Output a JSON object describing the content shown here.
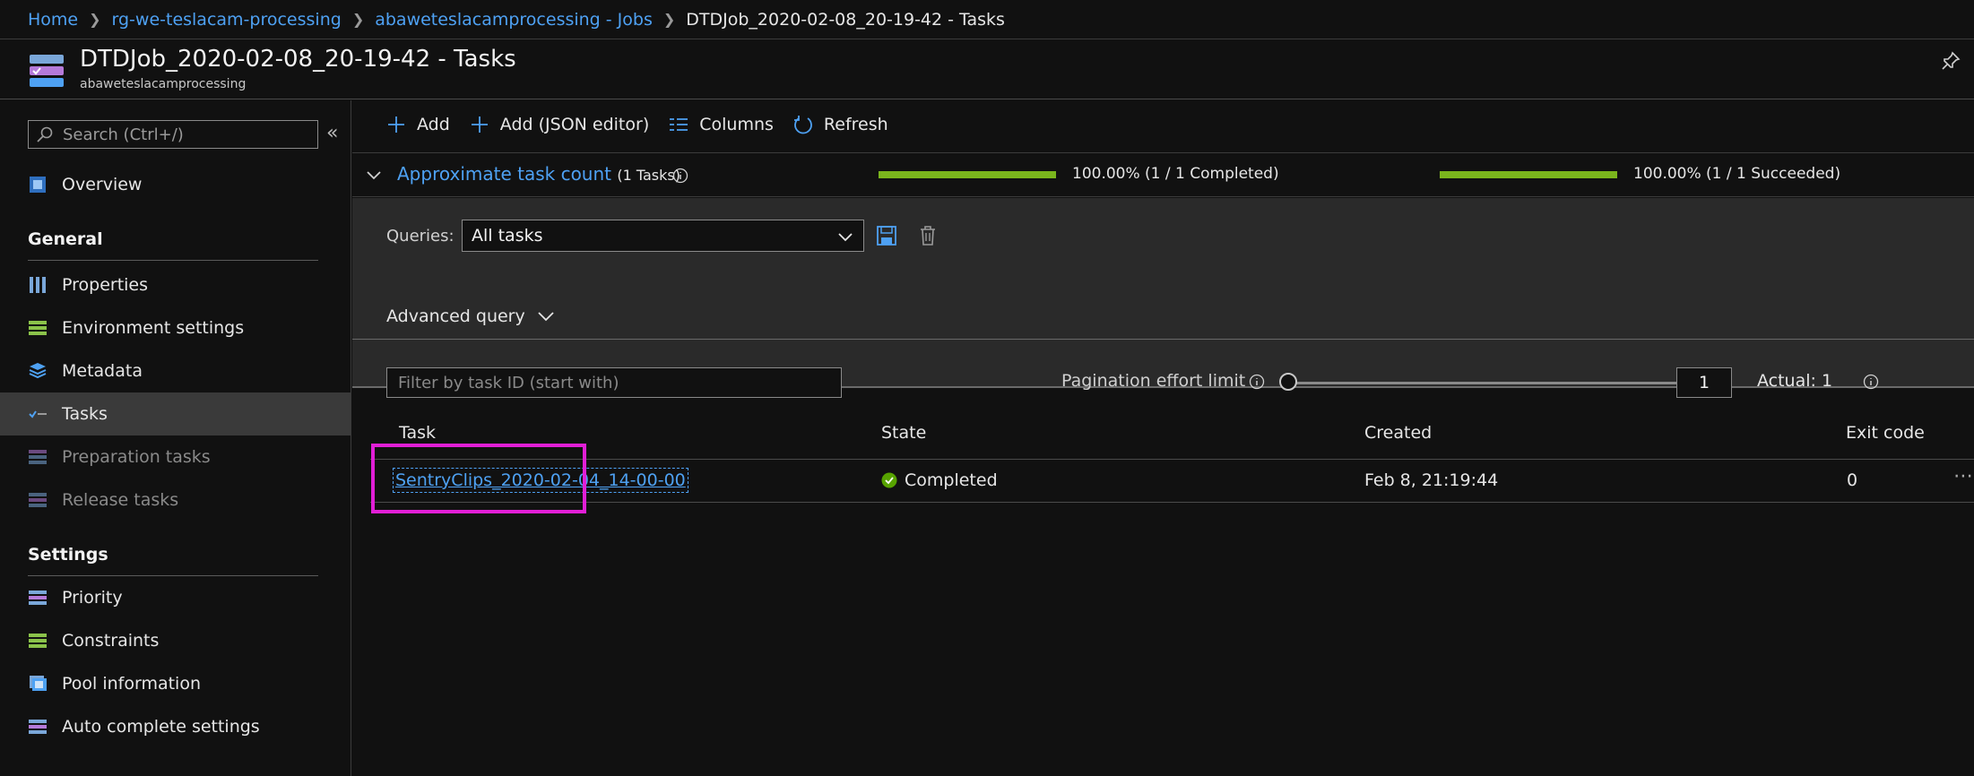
{
  "breadcrumb": {
    "items": [
      "Home",
      "rg-we-teslacam-processing",
      "abaweteslacamprocessing - Jobs"
    ],
    "current": "DTDJob_2020-02-08_20-19-42 - Tasks"
  },
  "header": {
    "title": "DTDJob_2020-02-08_20-19-42 - Tasks",
    "subtitle": "abaweteslacamprocessing"
  },
  "sidebar": {
    "search_placeholder": "Search (Ctrl+/)",
    "overview": "Overview",
    "general_title": "General",
    "general_items": [
      "Properties",
      "Environment settings",
      "Metadata",
      "Tasks",
      "Preparation tasks",
      "Release tasks"
    ],
    "settings_title": "Settings",
    "settings_items": [
      "Priority",
      "Constraints",
      "Pool information",
      "Auto complete settings"
    ]
  },
  "toolbar": {
    "add": "Add",
    "add_json": "Add (JSON editor)",
    "columns": "Columns",
    "refresh": "Refresh"
  },
  "task_count": {
    "title": "Approximate task count",
    "sub": "(1 Tasks)",
    "completed_text": "100.00% (1 / 1 Completed)",
    "completed_fraction": 1.0,
    "succeeded_text": "100.00% (1 / 1 Succeeded)",
    "succeeded_fraction": 1.0,
    "bar_color": "#7ab51d"
  },
  "queries": {
    "label": "Queries:",
    "selected": "All tasks",
    "advanced": "Advanced query"
  },
  "filter": {
    "placeholder": "Filter by task ID (start with)"
  },
  "pagination": {
    "label": "Pagination effort limit",
    "value": "1",
    "actual": "Actual: 1"
  },
  "table": {
    "headers": [
      "Task",
      "State",
      "Created",
      "Exit code"
    ],
    "rows": [
      {
        "task": "SentryClips_2020-02-04_14-00-00",
        "state": "Completed",
        "created": "Feb 8, 21:19:44",
        "exit_code": "0"
      }
    ]
  },
  "colors": {
    "accent": "#4ea1f3",
    "highlight": "#e11fd6",
    "success": "#57a300"
  }
}
